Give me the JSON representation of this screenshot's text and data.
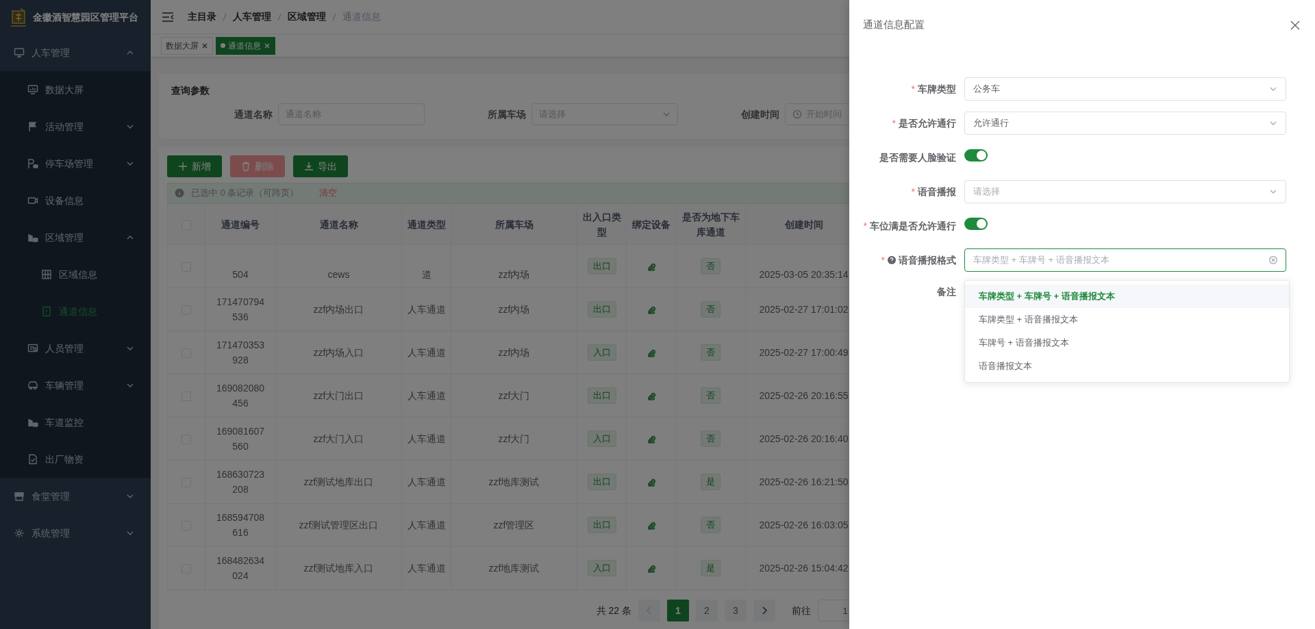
{
  "app": {
    "title": "金徽酒智慧园区管理平台"
  },
  "sidebar": {
    "items": [
      {
        "label": "人车管理",
        "selected": false,
        "expanded": true,
        "children": [
          {
            "label": "数据大屏",
            "selected": false
          },
          {
            "label": "活动管理",
            "selected": false,
            "expanded": false
          },
          {
            "label": "停车场管理",
            "selected": false,
            "expanded": false
          },
          {
            "label": "设备信息",
            "selected": false
          },
          {
            "label": "区域管理",
            "selected": false,
            "expanded": true,
            "children": [
              {
                "label": "区域信息",
                "selected": false
              },
              {
                "label": "通道信息",
                "selected": true
              }
            ]
          },
          {
            "label": "人员管理",
            "selected": false,
            "expanded": false
          },
          {
            "label": "车辆管理",
            "selected": false,
            "expanded": false
          },
          {
            "label": "车道监控",
            "selected": false
          },
          {
            "label": "出厂物资",
            "selected": false
          }
        ]
      },
      {
        "label": "食堂管理",
        "selected": false,
        "expanded": false
      },
      {
        "label": "系统管理",
        "selected": false,
        "expanded": false
      }
    ]
  },
  "breadcrumb": [
    "主目录",
    "人车管理",
    "区域管理",
    "通道信息"
  ],
  "tabs": [
    {
      "label": "数据大屏",
      "selected": false
    },
    {
      "label": "通道信息",
      "selected": true
    }
  ],
  "query": {
    "title": "查询参数",
    "fields": [
      {
        "label": "通道名称",
        "kind": "input",
        "placeholder": "通道名称"
      },
      {
        "label": "所属车场",
        "kind": "select",
        "placeholder": "请选择"
      },
      {
        "label": "创建时间",
        "kind": "date",
        "placeholder": "开始时间"
      }
    ]
  },
  "toolbar": [
    {
      "label": "新增",
      "kind": "add",
      "disabled": false
    },
    {
      "label": "删除",
      "kind": "delete",
      "disabled": true
    },
    {
      "label": "导出",
      "kind": "export",
      "disabled": false
    }
  ],
  "selection_alert": {
    "text": "已选中 0 条记录（可跨页）",
    "action": "清空"
  },
  "table": {
    "select_all_checked": false,
    "columns": [
      "通道编号",
      "通道名称",
      "通道类型",
      "所属车场",
      "出入口类型",
      "绑定设备",
      "是否为地下车库通道",
      "创建时间"
    ],
    "rows": [
      {
        "id": "504",
        "name": "cews",
        "type": "道",
        "lot": "zzf内场",
        "direction": "出口",
        "underground": "否",
        "created": "2025-03-05 20:35:14",
        "partial": true,
        "checked": false
      },
      {
        "id": "171470794536",
        "name": "zzf内场出口",
        "type": "人车通道",
        "lot": "zzf内场",
        "direction": "出口",
        "underground": "否",
        "created": "2025-02-27 17:01:02",
        "checked": false
      },
      {
        "id": "171470353928",
        "name": "zzf内场入口",
        "type": "人车通道",
        "lot": "zzf内场",
        "direction": "入口",
        "underground": "否",
        "created": "2025-02-27 17:00:49",
        "checked": false
      },
      {
        "id": "169082080456",
        "name": "zzf大门出口",
        "type": "人车通道",
        "lot": "zzf大门",
        "direction": "出口",
        "underground": "否",
        "created": "2025-02-26 20:16:55",
        "checked": false
      },
      {
        "id": "169081607560",
        "name": "zzf大门入口",
        "type": "人车通道",
        "lot": "zzf大门",
        "direction": "入口",
        "underground": "否",
        "created": "2025-02-26 20:16:40",
        "checked": false
      },
      {
        "id": "168630723208",
        "name": "zzf测试地库出口",
        "type": "人车通道",
        "lot": "zzf地库测试",
        "direction": "出口",
        "underground": "是",
        "created": "2025-02-26 16:21:50",
        "checked": false
      },
      {
        "id": "168594708616",
        "name": "zzf测试管理区出口",
        "type": "人车通道",
        "lot": "zzf管理区",
        "direction": "出口",
        "underground": "否",
        "created": "2025-02-26 16:03:05",
        "checked": false
      },
      {
        "id": "168482634024",
        "name": "zzf测试地库入口",
        "type": "人车通道",
        "lot": "zzf地库测试",
        "direction": "入口",
        "underground": "是",
        "created": "2025-02-26 15:04:42",
        "checked": false
      }
    ]
  },
  "pagination": {
    "total": "共 22 条",
    "prev_disabled": true,
    "next_disabled": false,
    "pages": [
      {
        "label": "1",
        "selected": true
      },
      {
        "label": "2",
        "selected": false
      },
      {
        "label": "3",
        "selected": false
      }
    ],
    "goto_label": "前往",
    "goto_value": "1"
  },
  "drawer": {
    "title": "通道信息配置",
    "fields": [
      {
        "label": "车牌类型",
        "mark": "*",
        "kind": "select",
        "value": "公务车"
      },
      {
        "label": "是否允许通行",
        "mark": "*",
        "kind": "select",
        "value": "允许通行"
      },
      {
        "label": "是否需要人脸验证",
        "kind": "switch",
        "on": true
      },
      {
        "label": "语音播报",
        "mark": "*",
        "kind": "select",
        "placeholder": "请选择"
      },
      {
        "label": "车位满是否允许通行",
        "mark": "*",
        "kind": "switch",
        "on": true
      },
      {
        "label": "语音播报格式",
        "mark": "*",
        "help": true,
        "kind": "autocomplete",
        "placeholder": "车牌类型 + 车牌号 + 语音播报文本",
        "focused": true,
        "expanded": true,
        "options": [
          {
            "label": "车牌类型 + 车牌号 + 语音播报文本",
            "selected": true
          },
          {
            "label": "车牌类型 + 语音播报文本",
            "selected": false
          },
          {
            "label": "车牌号 + 语音播报文本",
            "selected": false
          },
          {
            "label": "语音播报文本",
            "selected": false
          }
        ]
      },
      {
        "label": "备注",
        "kind": "textarea"
      }
    ]
  }
}
